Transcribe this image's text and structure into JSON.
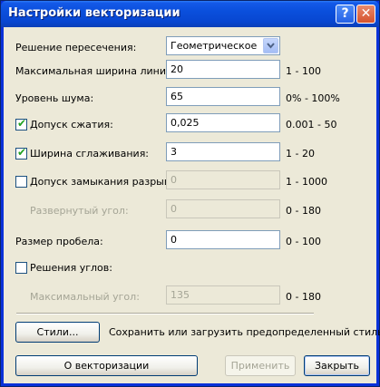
{
  "window": {
    "title": "Настройки векторизации",
    "help_label": "?",
    "close_label": "✕"
  },
  "fields": {
    "intersection": {
      "label": "Решение пересечения:",
      "value": "Геометрическое"
    },
    "max_line_width": {
      "label": "Максимальная ширина линии:",
      "value": "20",
      "range": "1 - 100"
    },
    "noise_level": {
      "label": "Уровень шума:",
      "value": "65",
      "range": "0% - 100%"
    },
    "compression_tolerance": {
      "label": "Допуск сжатия:",
      "value": "0,025",
      "range": "0.001 - 50",
      "checked": true
    },
    "smoothing_width": {
      "label": "Ширина сглаживания:",
      "value": "3",
      "range": "1 - 20",
      "checked": true
    },
    "gap_closure": {
      "label": "Допуск замыкания разрывов:",
      "value": "0",
      "range": "1 - 1000",
      "checked": false
    },
    "unfolded_angle": {
      "label": "Развернутый угол:",
      "value": "0",
      "range": "0 - 180"
    },
    "gap_size": {
      "label": "Размер пробела:",
      "value": "0",
      "range": "0 - 100"
    },
    "corner_solutions": {
      "label": "Решения углов:",
      "checked": false
    },
    "max_angle": {
      "label": "Максимальный угол:",
      "value": "135",
      "range": "0 - 180"
    }
  },
  "styles": {
    "button_label": "Стили...",
    "description": "Сохранить или загрузить предопределенный стиль"
  },
  "footer": {
    "about_label": "О векторизации",
    "apply_label": "Применить",
    "close_label": "Закрыть"
  },
  "colors": {
    "title_bar": "#0a4fdc",
    "dialog_bg": "#ece9d8",
    "check_mark": "#21a121"
  },
  "icons": {
    "dropdown": "chevron-down-icon",
    "check": "check-icon"
  }
}
